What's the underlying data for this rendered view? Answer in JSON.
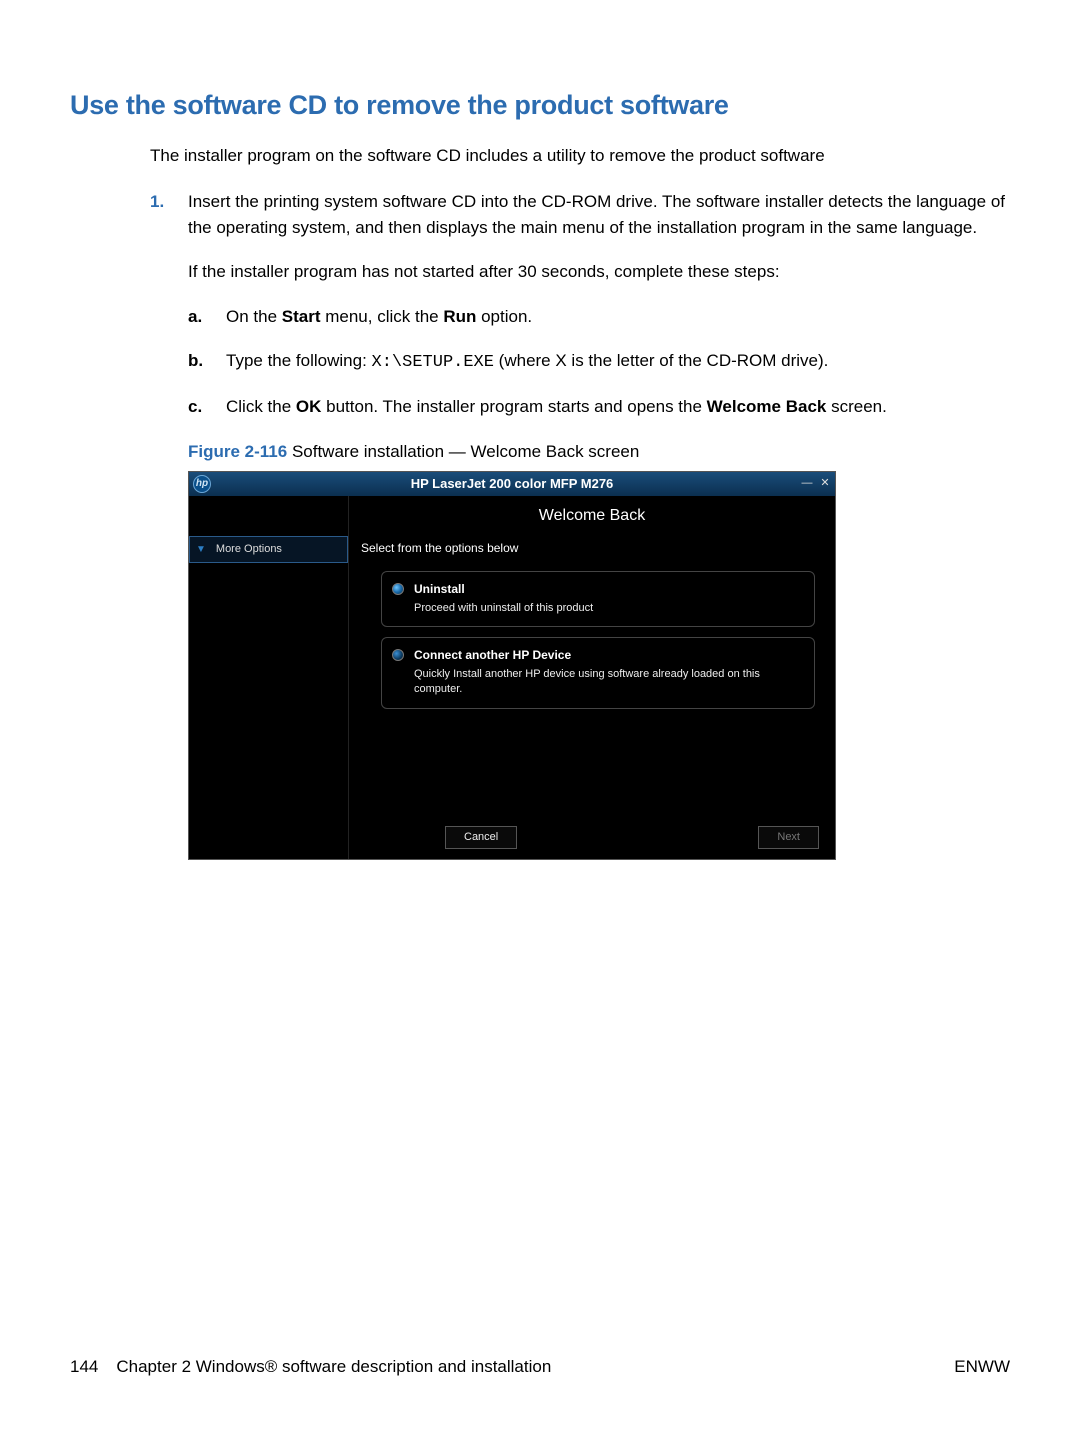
{
  "heading": "Use the software CD to remove the product software",
  "intro": "The installer program on the software CD includes a utility to remove the product software",
  "step1": {
    "marker": "1.",
    "para1_parts": [
      "Insert the printing system software CD into the CD-ROM drive. The software installer detects the language of the operating system, and then displays the main menu of the installation program in the same language."
    ],
    "para2": "If the installer program has not started after 30 seconds, complete these steps:",
    "sub_a": {
      "marker": "a.",
      "pre": "On the ",
      "b1": "Start",
      "mid": " menu, click the ",
      "b2": "Run",
      "post": " option."
    },
    "sub_b": {
      "marker": "b.",
      "pre": "Type the following: ",
      "code": "X:\\SETUP.EXE",
      "post": " (where X is the letter of the CD-ROM drive)."
    },
    "sub_c": {
      "marker": "c.",
      "pre": "Click the ",
      "b1": "OK",
      "mid": " button. The installer program starts and opens the ",
      "b2": "Welcome Back",
      "post": " screen."
    }
  },
  "figure": {
    "label": "Figure 2-116",
    "caption": "  Software installation — Welcome Back screen"
  },
  "installer": {
    "logo_text": "hp",
    "title": "HP LaserJet 200 color MFP M276",
    "minimize": "—",
    "close": "✕",
    "more_options": "More Options",
    "welcome": "Welcome Back",
    "select_text": "Select from the options below",
    "opt_uninstall": {
      "title": "Uninstall",
      "desc": "Proceed with uninstall of this product"
    },
    "opt_connect": {
      "title": "Connect another HP Device",
      "desc": "Quickly Install another HP device using software already loaded on this computer."
    },
    "cancel": "Cancel",
    "next": "Next"
  },
  "footer": {
    "page": "144",
    "chapter": "Chapter 2   Windows® software description and installation",
    "right": "ENWW"
  }
}
